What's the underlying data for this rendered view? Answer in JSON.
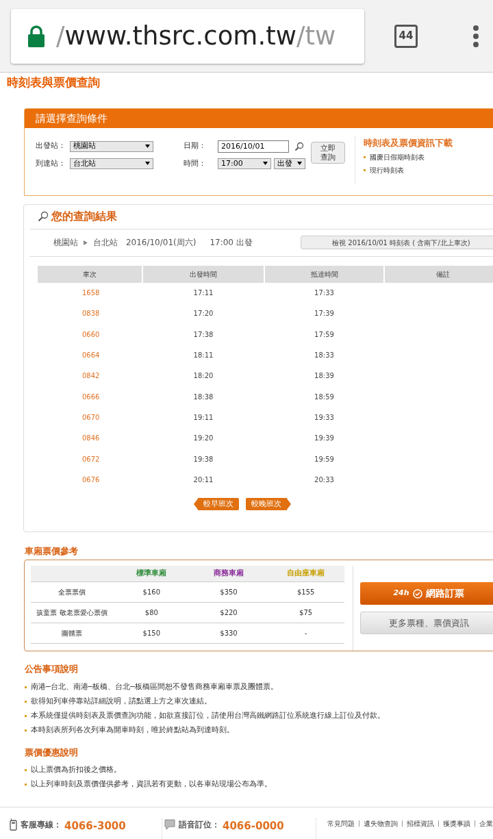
{
  "browser": {
    "url_prefix": "/",
    "url_main": "www.thsrc.com.tw",
    "url_suffix": "/tw",
    "tab_count": "44"
  },
  "page_title": "時刻表與票價查詢",
  "search_panel": {
    "title": "請選擇查詢條件",
    "fields": [
      {
        "kind": "select",
        "label": "出發站：",
        "value": "桃園站"
      },
      {
        "kind": "select",
        "label": "到達站：",
        "value": "台北站"
      },
      {
        "kind": "date",
        "label": "日期：",
        "value": "2016/10/01"
      },
      {
        "kind": "time",
        "label": "時間：",
        "value": "17:00",
        "mode": "出發"
      }
    ],
    "submit": "立即查詢",
    "downloads": {
      "title": "時刻表及票價資訊下載",
      "links": [
        "國慶日假期時刻表",
        "現行時刻表"
      ]
    }
  },
  "results": {
    "title": "您的查詢結果",
    "from": "桃園站",
    "to": "台北站",
    "date": "2016/10/01(周六)",
    "time": "17:00 出發",
    "view_button": "檢視 2016/10/01 時刻表 ( 含南下/北上車次)",
    "columns": [
      "車次",
      "出發時間",
      "抵達時間",
      "備註"
    ],
    "rows": [
      [
        "1658",
        "17:11",
        "17:33"
      ],
      [
        "0838",
        "17:20",
        "17:39"
      ],
      [
        "0660",
        "17:38",
        "17:59"
      ],
      [
        "0664",
        "18:11",
        "18:33"
      ],
      [
        "0842",
        "18:20",
        "18:39"
      ],
      [
        "0666",
        "18:38",
        "18:59"
      ],
      [
        "0670",
        "19:11",
        "19:33"
      ],
      [
        "0846",
        "19:20",
        "19:39"
      ],
      [
        "0672",
        "19:38",
        "19:59"
      ],
      [
        "0676",
        "20:11",
        "20:33"
      ]
    ],
    "earlier": "較早班次",
    "later": "較晚班次"
  },
  "fares": {
    "title": "車廂票價參考",
    "car_classes": [
      {
        "label": "標準車廂",
        "color": "#2e8b3a"
      },
      {
        "label": "商務車廂",
        "color": "#8b2e9b"
      },
      {
        "label": "自由座車廂",
        "color": "#c8a000"
      }
    ],
    "fare_rows": [
      [
        "全票票價",
        "$160",
        "$350",
        "$155"
      ],
      [
        "孩童票 敬老票愛心票價",
        "$80",
        "$220",
        "$75"
      ],
      [
        "團體票",
        "$150",
        "$330",
        "-"
      ]
    ],
    "book_prefix": "24h",
    "book_button": "網路訂票",
    "more_button": "更多票種、票價資訊"
  },
  "notes": [
    {
      "title": "公告事項說明",
      "items": [
        "南港─台北、南港─板橋、台北─板橋區間恕不發售商務車廂車票及團體票。",
        "欲得知列車停靠站詳細說明，請點選上方之車次連結。",
        "本系統僅提供時刻表及票價查詢功能，如欲直接訂位，請使用台灣高鐵網路訂位系統進行線上訂位及付款。",
        "本時刻表所列各次列車為開車時刻，唯於終點站為到達時刻。"
      ]
    },
    {
      "title": "票價優惠說明",
      "items": [
        "以上票價為折扣後之價格。",
        "以上列車時刻及票價僅供參考，資訊若有更動，以各車站現場公布為準。"
      ]
    }
  ],
  "footer": {
    "contacts": [
      {
        "kind": "phone",
        "label": "客服專線：",
        "number": "4066-3000"
      },
      {
        "kind": "chat",
        "label": "語音訂位：",
        "number": "4066-0000"
      }
    ],
    "links": [
      "常見問題",
      "遺失物查詢",
      "招標資訊",
      "獲獎事蹟",
      "企業"
    ]
  }
}
